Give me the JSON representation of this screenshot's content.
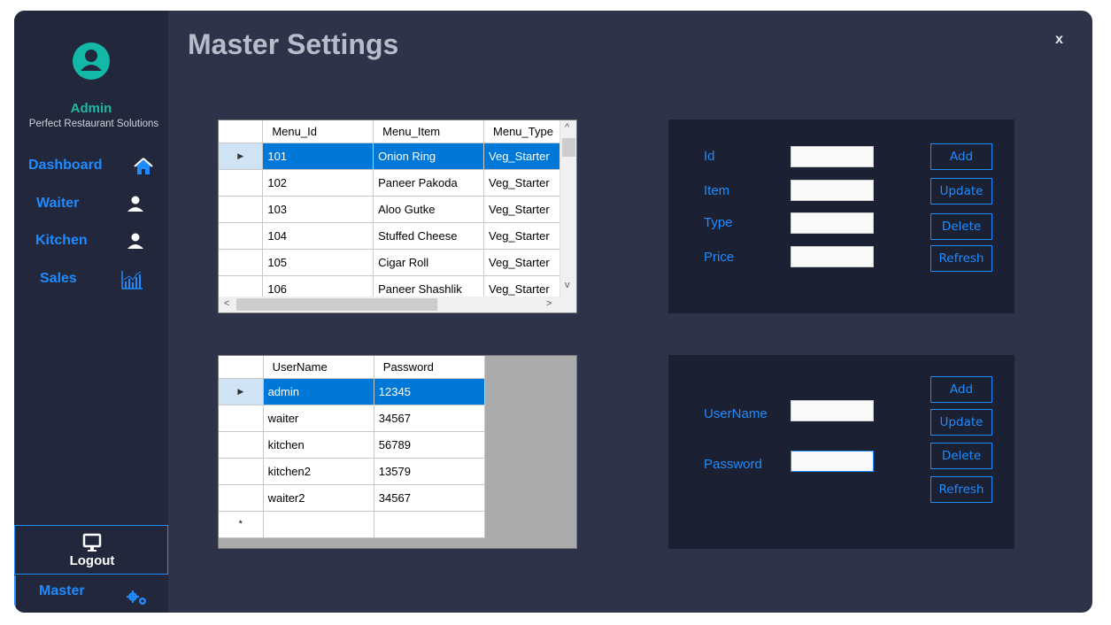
{
  "sidebar": {
    "user_name": "Admin",
    "company": "Perfect Restaurant Solutions",
    "nav": [
      {
        "label": "Dashboard",
        "icon": "home-icon"
      },
      {
        "label": "Waiter",
        "icon": "user-icon"
      },
      {
        "label": "Kitchen",
        "icon": "user-icon"
      },
      {
        "label": "Sales",
        "icon": "bar-chart-icon"
      }
    ],
    "logout_label": "Logout",
    "master_label": "Master"
  },
  "header": {
    "title": "Master Settings",
    "close_label": "x"
  },
  "menu_grid": {
    "columns": [
      "Menu_Id",
      "Menu_Item",
      "Menu_Type"
    ],
    "rows": [
      [
        "101",
        "Onion Ring",
        "Veg_Starter"
      ],
      [
        "102",
        "Paneer Pakoda",
        "Veg_Starter"
      ],
      [
        "103",
        "Aloo Gutke",
        "Veg_Starter"
      ],
      [
        "104",
        "Stuffed Cheese",
        "Veg_Starter"
      ],
      [
        "105",
        "Cigar Roll",
        "Veg_Starter"
      ],
      [
        "106",
        "Paneer Shashlik",
        "Veg_Starter"
      ]
    ],
    "selected_row": 0,
    "row_marker": "▶",
    "scroll_up": "^",
    "scroll_down": "v",
    "scroll_left": "<",
    "scroll_right": ">"
  },
  "user_grid": {
    "columns": [
      "UserName",
      "Password"
    ],
    "rows": [
      [
        "admin",
        "12345"
      ],
      [
        "waiter",
        "34567"
      ],
      [
        "kitchen",
        "56789"
      ],
      [
        "kitchen2",
        "13579"
      ],
      [
        "waiter2",
        "34567"
      ]
    ],
    "selected_row": 0,
    "row_marker": "▶",
    "new_row_marker": "*"
  },
  "menu_form": {
    "labels": {
      "id": "Id",
      "item": "Item",
      "type": "Type",
      "price": "Price"
    },
    "values": {
      "id": "",
      "item": "",
      "type": "",
      "price": ""
    },
    "buttons": {
      "add": "Add",
      "update": "Update",
      "delete": "Delete",
      "refresh": "Refresh"
    }
  },
  "user_form": {
    "labels": {
      "username": "UserName",
      "password": "Password"
    },
    "values": {
      "username": "",
      "password": ""
    },
    "buttons": {
      "add": "Add",
      "update": "Update",
      "delete": "Delete",
      "refresh": "Refresh"
    }
  },
  "colors": {
    "accent": "#1e8cff",
    "sidebar_bg": "#23273b",
    "main_bg": "#2f3349",
    "panel_bg": "#1c2033",
    "teal": "#1fb6a3",
    "selection": "#0078d7"
  }
}
